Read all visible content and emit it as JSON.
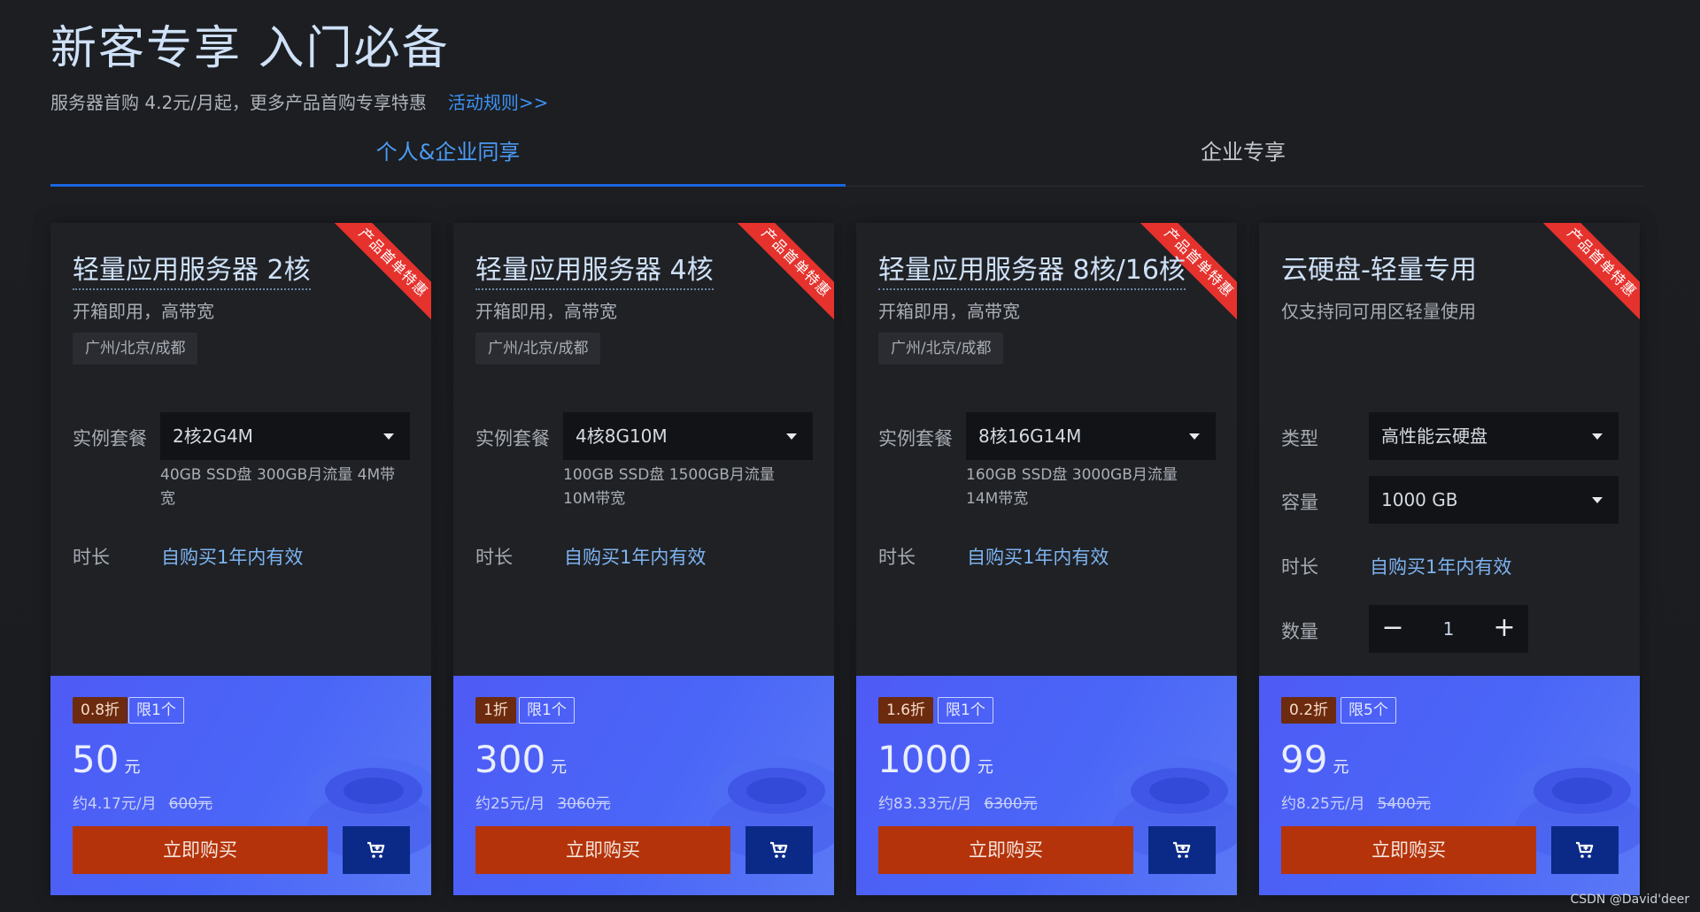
{
  "hero": {
    "title": "新客专享 入门必备",
    "subtitle": "服务器首购 4.2元/月起，更多产品首购专享特惠",
    "rules_link": "活动规则>>"
  },
  "tabs": [
    {
      "label": "个人&企业同享",
      "active": true
    },
    {
      "label": "企业专享",
      "active": false
    }
  ],
  "cards": [
    {
      "ribbon": "产品首单特惠",
      "title": "轻量应用服务器 2核",
      "desc": "开箱即用，高带宽",
      "region": "广州/北京/成都",
      "field1_label": "实例套餐",
      "field1_value": "2核2G4M",
      "spec_note": "40GB SSD盘 300GB月流量 4M带宽",
      "duration_label": "时长",
      "duration_value": "自购买1年内有效",
      "discount": "0.8折",
      "limit": "限1个",
      "price": "50",
      "price_unit": "元",
      "monthly": "约4.17元/月",
      "original": "600元",
      "buy_label": "立即购买"
    },
    {
      "ribbon": "产品首单特惠",
      "title": "轻量应用服务器 4核",
      "desc": "开箱即用，高带宽",
      "region": "广州/北京/成都",
      "field1_label": "实例套餐",
      "field1_value": "4核8G10M",
      "spec_note": "100GB SSD盘 1500GB月流量 10M带宽",
      "duration_label": "时长",
      "duration_value": "自购买1年内有效",
      "discount": "1折",
      "limit": "限1个",
      "price": "300",
      "price_unit": "元",
      "monthly": "约25元/月",
      "original": "3060元",
      "buy_label": "立即购买"
    },
    {
      "ribbon": "产品首单特惠",
      "title": "轻量应用服务器 8核/16核",
      "desc": "开箱即用，高带宽",
      "region": "广州/北京/成都",
      "field1_label": "实例套餐",
      "field1_value": "8核16G14M",
      "spec_note": "160GB SSD盘 3000GB月流量 14M带宽",
      "duration_label": "时长",
      "duration_value": "自购买1年内有效",
      "discount": "1.6折",
      "limit": "限1个",
      "price": "1000",
      "price_unit": "元",
      "monthly": "约83.33元/月",
      "original": "6300元",
      "buy_label": "立即购买"
    },
    {
      "ribbon": "产品首单特惠",
      "title": "云硬盘-轻量专用",
      "desc": "仅支持同可用区轻量使用",
      "type_label": "类型",
      "type_value": "高性能云硬盘",
      "capacity_label": "容量",
      "capacity_value": "1000 GB",
      "duration_label": "时长",
      "duration_value": "自购买1年内有效",
      "qty_label": "数量",
      "qty_value": "1",
      "discount": "0.2折",
      "limit": "限5个",
      "price": "99",
      "price_unit": "元",
      "monthly": "约8.25元/月",
      "original": "5400元",
      "buy_label": "立即购买"
    }
  ],
  "watermark": "CSDN @David'deer",
  "colors": {
    "accent_blue": "#1a66e0",
    "buy_orange": "#b5330a",
    "cart_navy": "#0b2a88",
    "ribbon_red": "#e5322d"
  }
}
